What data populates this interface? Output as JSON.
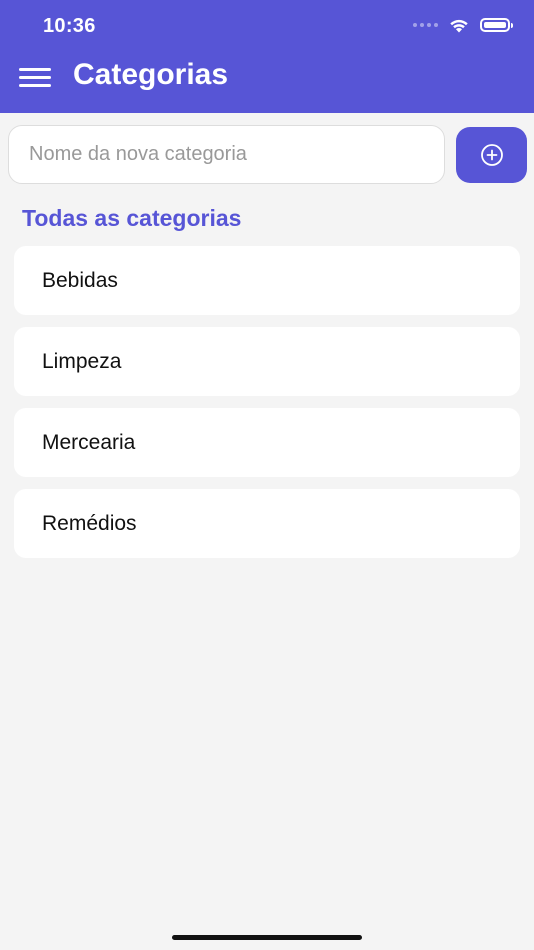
{
  "status_bar": {
    "time": "10:36"
  },
  "header": {
    "title": "Categorias",
    "background_color": "#5755d6"
  },
  "new_category": {
    "placeholder": "Nome da nova categoria",
    "value": "",
    "add_icon": "plus-circle-icon"
  },
  "section": {
    "title": "Todas as categorias"
  },
  "categories": [
    {
      "label": "Bebidas"
    },
    {
      "label": "Limpeza"
    },
    {
      "label": "Mercearia"
    },
    {
      "label": "Remédios"
    }
  ]
}
